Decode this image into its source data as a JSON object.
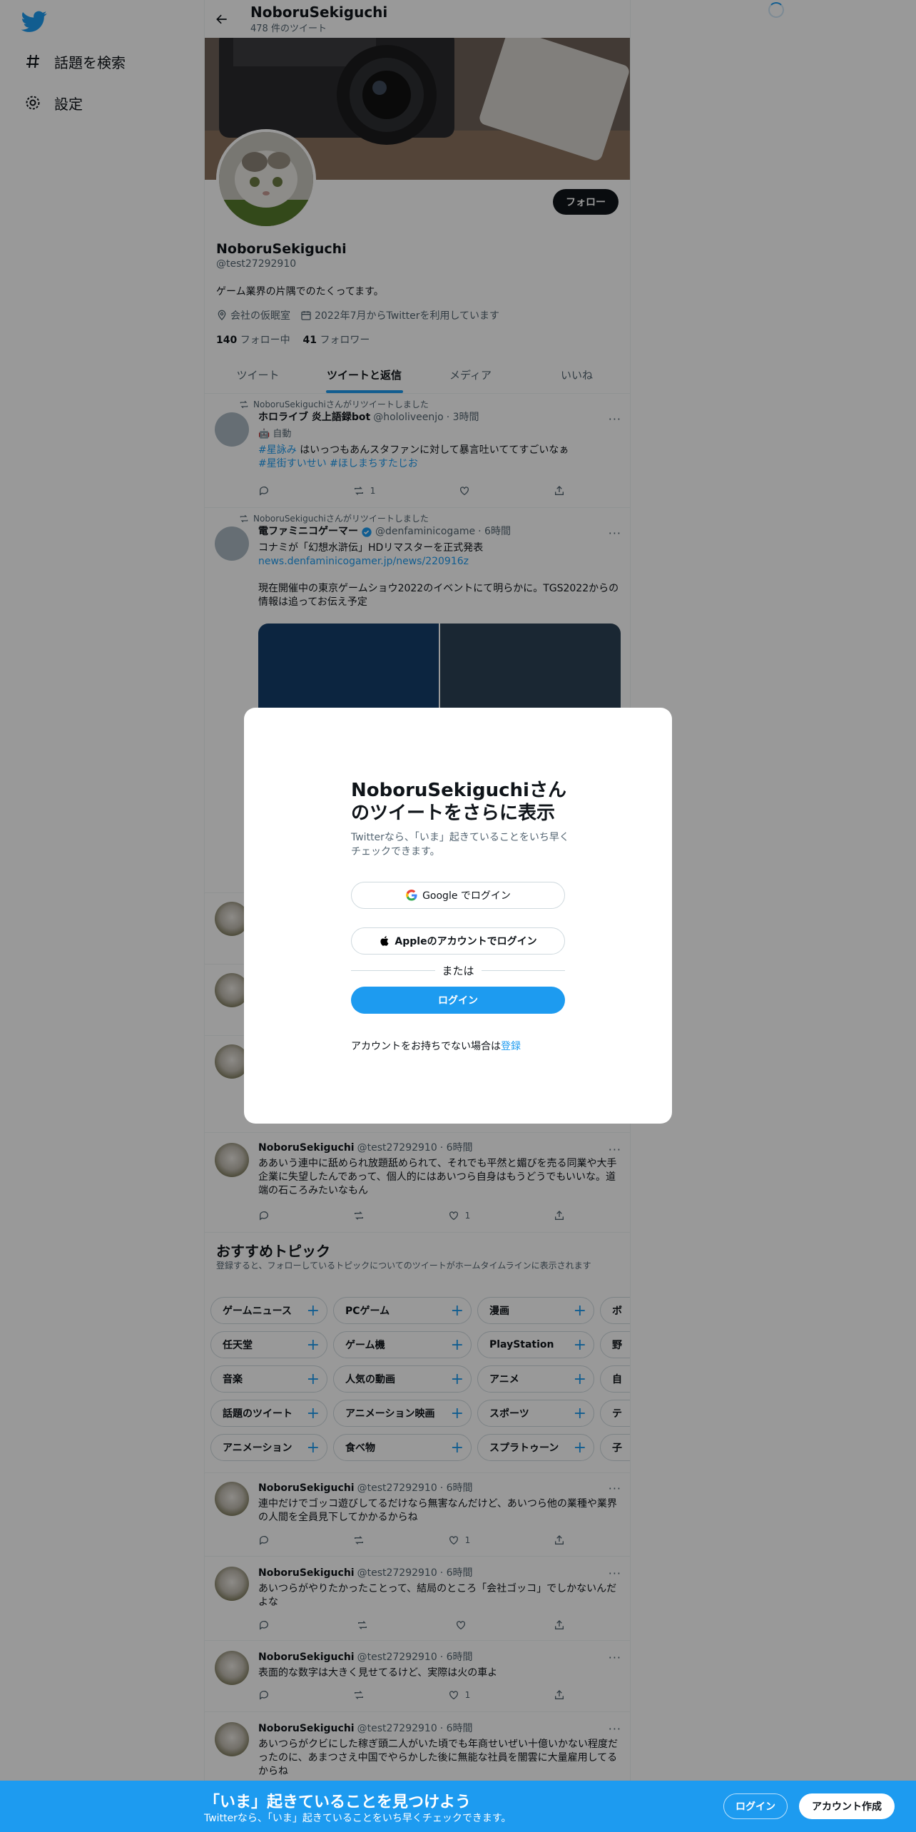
{
  "sidebar": {
    "explore_label": "話題を検索",
    "settings_label": "設定"
  },
  "header": {
    "name": "NoboruSekiguchi",
    "tweet_count": "478 件のツイート"
  },
  "profile": {
    "follow_label": "フォロー",
    "name": "NoboruSekiguchi",
    "handle": "@test27292910",
    "bio": "ゲーム業界の片隅でのたくってます。",
    "location": "会社の仮眠室",
    "joined": "2022年7月からTwitterを利用しています",
    "following_count": "140",
    "following_label": "フォロー中",
    "followers_count": "41",
    "followers_label": "フォロワー"
  },
  "tabs": [
    "ツイート",
    "ツイートと返信",
    "メディア",
    "いいね"
  ],
  "tweets": [
    {
      "retweet_note": "NoboruSekiguchiさんがリツイートしました",
      "name": "ホロライブ 炎上語録bot",
      "handle": "@hololiveenjo",
      "time": "· 3時間",
      "badge": "自動",
      "hashtag1": "#星詠み",
      "text": "はいっつもあんスタファンに対して暴言吐いててすごいなぁ",
      "hashtag2": "#星街すいせい #ほしまちすたじお",
      "retweets": "1"
    },
    {
      "retweet_note": "NoboruSekiguchiさんがリツイートしました",
      "name": "電ファミニコゲーマー",
      "handle": "@denfaminicogame",
      "time": "· 6時間",
      "text1": "コナミが「幻想水滸伝」HDリマスターを正式発表",
      "link": "news.denfaminicogamer.jp/news/220916z",
      "text2": "現在開催中の東京ゲームショウ2022のイベントにて明らかに。TGS2022からの情報は追ってお伝え予定"
    },
    {
      "name": "NoboruSekiguchi",
      "handle": "@test27292910",
      "time": "· 6時間",
      "text": "ああいう連中に舐められ放題舐められて、それでも平然と媚びを売る同業や大手企業に失望したんであって、個人的にはあいつら自身はもうどうでもいいな。道端の石ころみたいなもん",
      "likes": "1"
    }
  ],
  "topics": {
    "title": "おすすめトピック",
    "subtitle": "登録すると、フォローしているトピックについてのツイートがホームタイムラインに表示されます",
    "chips": [
      "ゲームニュース",
      "PCゲーム",
      "漫画",
      "ボ",
      "任天堂",
      "ゲーム機",
      "PlayStation",
      "野",
      "音楽",
      "人気の動画",
      "アニメ",
      "自",
      "話題のツイート",
      "アニメーション映画",
      "スポーツ",
      "テ",
      "アニメーション",
      "食べ物",
      "スプラトゥーン",
      "子"
    ]
  },
  "tweets2": [
    {
      "name": "NoboruSekiguchi",
      "handle": "@test27292910",
      "time": "· 6時間",
      "text": "連中だけでゴッコ遊びしてるだけなら無害なんだけど、あいつら他の業種や業界の人間を全員見下してかかるからね",
      "likes": "1"
    },
    {
      "name": "NoboruSekiguchi",
      "handle": "@test27292910",
      "time": "· 6時間",
      "text": "あいつらがやりたかったことって、結局のところ「会社ゴッコ」でしかないんだよな"
    },
    {
      "name": "NoboruSekiguchi",
      "handle": "@test27292910",
      "time": "· 6時間",
      "text": "表面的な数字は大きく見せてるけど、実際は火の車よ",
      "likes": "1"
    },
    {
      "name": "NoboruSekiguchi",
      "handle": "@test27292910",
      "time": "· 6時間",
      "text": "あいつらがクビにした稼ぎ頭二人がいた頃でも年商せいぜい十億いかない程度だったのに、あまつさえ中国でやらかした後に無能な社員を闇雲に大量雇用してるからね"
    }
  ],
  "modal": {
    "title": "NoboruSekiguchiさんのツイートをさらに表示",
    "subtitle": "Twitterなら、「いま」起きていることをいち早くチェックできます。",
    "google_label": "Google でログイン",
    "apple_label": "Appleのアカウントでログイン",
    "or_label": "または",
    "login_label": "ログイン",
    "signup_prompt": "アカウントをお持ちでない場合は",
    "signup_link": "登録"
  },
  "bottom_bar": {
    "title": "「いま」起きていることを見つけよう",
    "subtitle": "Twitterなら、「いま」起きていることをいち早くチェックできます。",
    "login_label": "ログイン",
    "signup_label": "アカウント作成"
  },
  "colors": {
    "accent": "#1d9bf0",
    "text": "#0f1419",
    "secondary": "#536471",
    "overlay": "rgba(0,0,0,0.4)"
  }
}
